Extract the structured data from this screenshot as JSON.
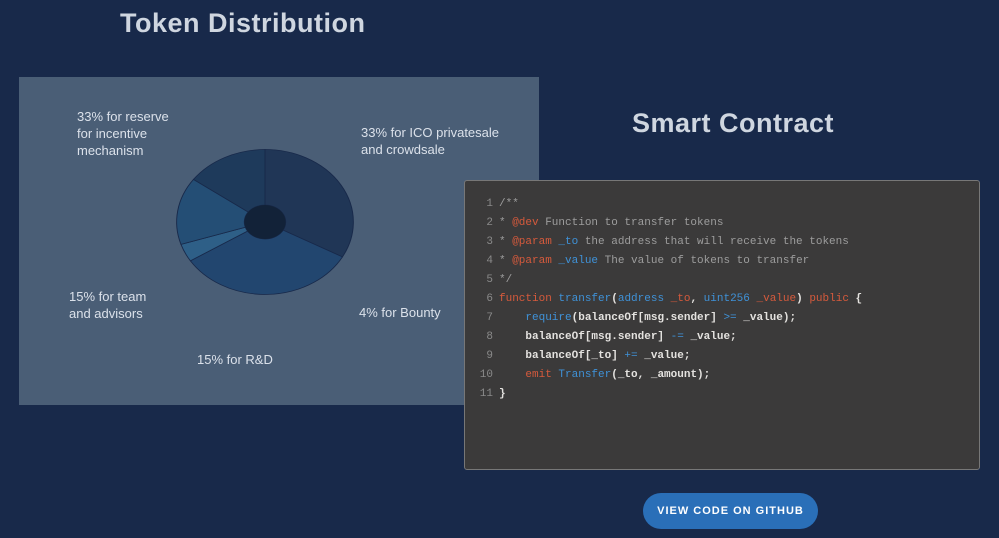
{
  "headings": {
    "token_distribution": "Token Distribution",
    "smart_contract": "Smart Contract"
  },
  "chart_data": {
    "type": "pie",
    "title": "Token Distribution",
    "slices": [
      {
        "label": "33% for reserve for incentive mechanism",
        "value": 33,
        "color": "#203656"
      },
      {
        "label": "33% for ICO privatesale and crowdsale",
        "value": 33,
        "color": "#22466f"
      },
      {
        "label": "4% for Bounty",
        "value": 4,
        "color": "#2e5f87"
      },
      {
        "label": "15% for R&D",
        "value": 15,
        "color": "#244e75"
      },
      {
        "label": "15% for team and advisors",
        "value": 15,
        "color": "#1e3a5b"
      }
    ]
  },
  "chart_labels": {
    "reserve": "33% for reserve\nfor incentive\nmechanism",
    "ico": "33% for ICO privatesale\nand crowdsale",
    "bounty": "4% for Bounty",
    "rnd": "15% for R&D",
    "team": "15% for team\nand advisors"
  },
  "code": {
    "lines": [
      [
        {
          "cls": "tok-comment",
          "t": "/**"
        }
      ],
      [
        {
          "cls": "tok-comment",
          "t": "* "
        },
        {
          "cls": "tok-tag",
          "t": "@dev"
        },
        {
          "cls": "tok-comment",
          "t": " Function to transfer tokens"
        }
      ],
      [
        {
          "cls": "tok-comment",
          "t": "* "
        },
        {
          "cls": "tok-tag",
          "t": "@param"
        },
        {
          "cls": "tok-type",
          "t": " _to"
        },
        {
          "cls": "tok-comment",
          "t": " the address that will receive the tokens"
        }
      ],
      [
        {
          "cls": "tok-comment",
          "t": "* "
        },
        {
          "cls": "tok-tag",
          "t": "@param"
        },
        {
          "cls": "tok-type",
          "t": " _value"
        },
        {
          "cls": "tok-comment",
          "t": " The value of tokens to transfer"
        }
      ],
      [
        {
          "cls": "tok-comment",
          "t": "*/"
        }
      ],
      [
        {
          "cls": "tok-kw",
          "t": "function"
        },
        {
          "cls": "tok-fn",
          "t": " transfer"
        },
        {
          "cls": "tok-plain",
          "t": "("
        },
        {
          "cls": "tok-type",
          "t": "address"
        },
        {
          "cls": "tok-param",
          "t": " _to"
        },
        {
          "cls": "tok-plain",
          "t": ", "
        },
        {
          "cls": "tok-type",
          "t": "uint256"
        },
        {
          "cls": "tok-param",
          "t": " _value"
        },
        {
          "cls": "tok-plain",
          "t": ") "
        },
        {
          "cls": "tok-kw",
          "t": "public"
        },
        {
          "cls": "tok-plain",
          "t": " {"
        }
      ],
      [
        {
          "cls": "tok-plain",
          "t": "    "
        },
        {
          "cls": "tok-fn",
          "t": "require"
        },
        {
          "cls": "tok-plain",
          "t": "(balanceOf[msg.sender] "
        },
        {
          "cls": "tok-op",
          "t": ">="
        },
        {
          "cls": "tok-plain",
          "t": " _value);"
        }
      ],
      [
        {
          "cls": "tok-plain",
          "t": "    balanceOf[msg.sender] "
        },
        {
          "cls": "tok-op",
          "t": "-="
        },
        {
          "cls": "tok-plain",
          "t": " _value;"
        }
      ],
      [
        {
          "cls": "tok-plain",
          "t": "    balanceOf[_to] "
        },
        {
          "cls": "tok-op",
          "t": "+="
        },
        {
          "cls": "tok-plain",
          "t": " _value;"
        }
      ],
      [
        {
          "cls": "tok-plain",
          "t": "    "
        },
        {
          "cls": "tok-kw",
          "t": "emit"
        },
        {
          "cls": "tok-fn",
          "t": " Transfer"
        },
        {
          "cls": "tok-plain",
          "t": "(_to, _amount);"
        }
      ],
      [
        {
          "cls": "tok-plain",
          "t": "}"
        }
      ]
    ]
  },
  "button": {
    "label": "VIEW CODE ON GITHUB"
  }
}
